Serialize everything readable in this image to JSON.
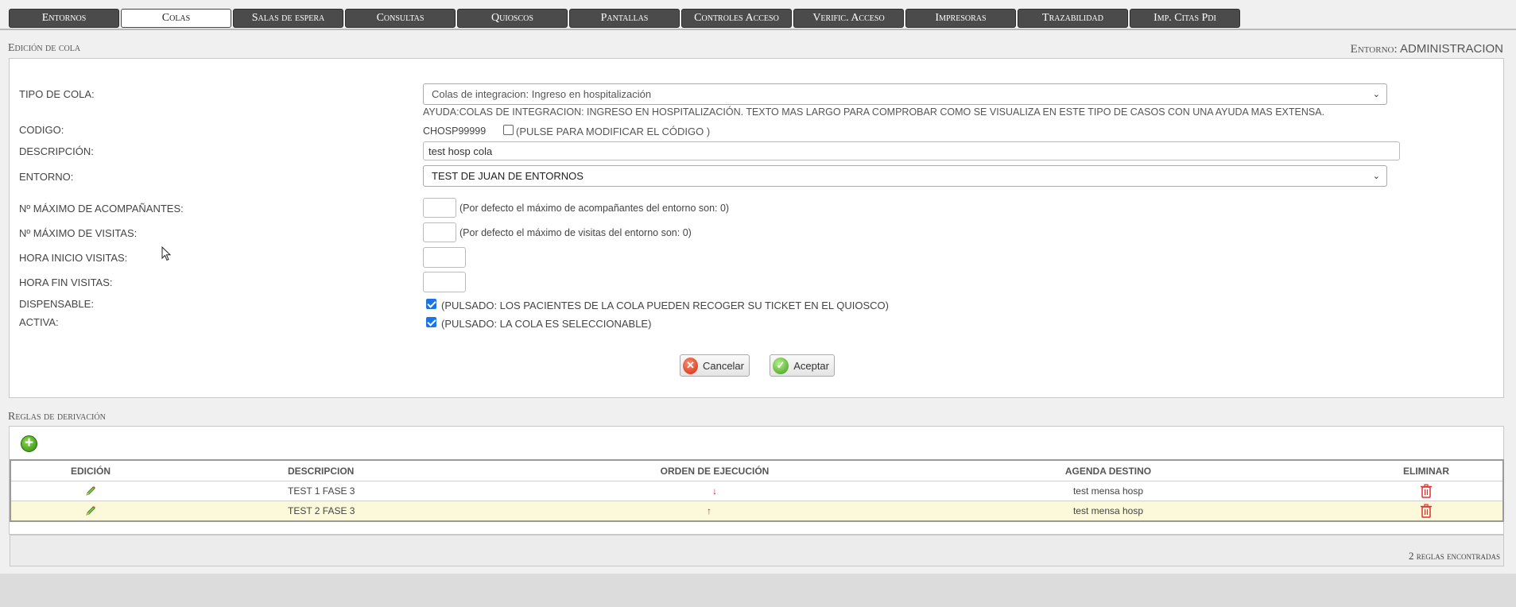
{
  "tabs": [
    "Entornos",
    "Colas",
    "Salas de espera",
    "Consultas",
    "Quioscos",
    "Pantallas",
    "Controles Acceso",
    "Verific. Acceso",
    "Impresoras",
    "Trazabilidad",
    "Imp. Citas Pdi"
  ],
  "active_tab": "Colas",
  "header": {
    "section_title": "Edición de cola",
    "env_key": "Entorno:",
    "env_value": "ADMINISTRACION"
  },
  "form": {
    "tipo_label": "TIPO DE COLA:",
    "tipo_value": "Colas de integracion: Ingreso en hospitalización",
    "ayuda": "AYUDA:COLAS DE INTEGRACION: INGRESO EN HOSPITALIZACIÓN. TEXTO MAS LARGO PARA COMPROBAR COMO SE VISUALIZA EN ESTE TIPO DE CASOS CON UNA AYUDA MAS EXTENSA.",
    "codigo_label": "CODIGO:",
    "codigo_value": "CHOSP99999",
    "codigo_hint": "(PULSE PARA MODIFICAR EL CÓDIGO )",
    "codigo_checked": false,
    "descripcion_label": "DESCRIPCIÓN:",
    "descripcion_value": "test hosp cola",
    "entorno_label": "ENTORNO:",
    "entorno_value": "TEST DE JUAN DE ENTORNOS",
    "max_acomp_label": "Nº MÁXIMO DE ACOMPAÑANTES:",
    "max_acomp_hint": "(Por defecto el máximo de acompañantes del entorno son: 0)",
    "max_visitas_label": "Nº MÁXIMO DE VISITAS:",
    "max_visitas_hint": "(Por defecto el máximo de visitas del entorno son: 0)",
    "hora_inicio_label": "HORA INICIO VISITAS:",
    "hora_fin_label": "HORA FIN VISITAS:",
    "dispensable_label": "DISPENSABLE:",
    "dispensable_hint": "(PULSADO: LOS PACIENTES DE LA COLA PUEDEN RECOGER SU TICKET EN EL QUIOSCO)",
    "dispensable_checked": true,
    "activa_label": "ACTIVA:",
    "activa_hint": "(PULSADO: LA COLA ES SELECCIONABLE)",
    "activa_checked": true,
    "cancel_label": "Cancelar",
    "accept_label": "Aceptar"
  },
  "rules": {
    "title": "Reglas de derivación",
    "headers": {
      "edicion": "EDICIÓN",
      "descripcion": "DESCRIPCION",
      "orden": "ORDEN DE EJECUCIÓN",
      "agenda": "AGENDA DESTINO",
      "eliminar": "ELIMINAR"
    },
    "rows": [
      {
        "descripcion": "TEST 1 FASE 3",
        "orden_icon": "arrow-down-icon",
        "agenda": "test mensa hosp"
      },
      {
        "descripcion": "TEST 2 FASE 3",
        "orden_icon": "arrow-up-icon",
        "agenda": "test mensa hosp"
      }
    ],
    "count_text": "2 reglas encontradas"
  },
  "colors": {
    "tab_bg": "#4b4b4b",
    "highlight_row": "#fbf9d9",
    "arrow": "#e31b1b",
    "checkbox": "#1a73e8"
  }
}
